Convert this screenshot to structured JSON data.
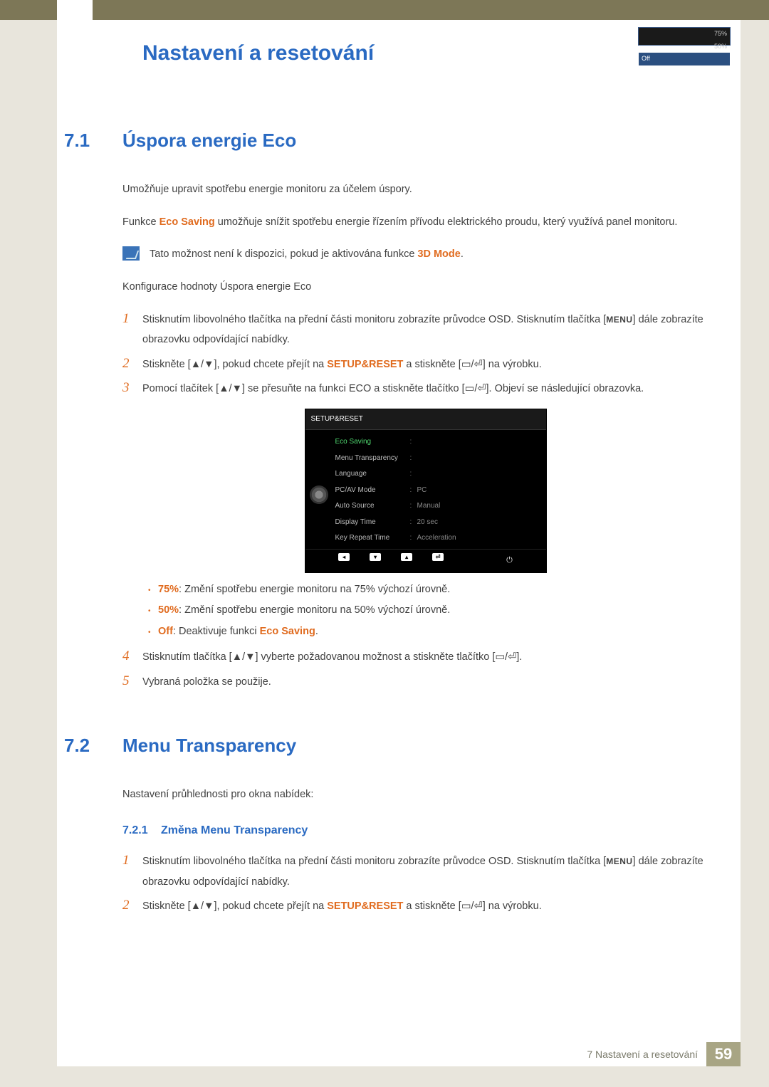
{
  "chapter_title": "Nastavení a resetování",
  "section1": {
    "num": "7.1",
    "title": "Úspora energie Eco",
    "p1": "Umožňuje upravit spotřebu energie monitoru za účelem úspory.",
    "p2a": "Funkce ",
    "p2_hl": "Eco Saving",
    "p2b": " umožňuje snížit spotřebu energie řízením přívodu elektrického proudu, který využívá panel monitoru.",
    "note_a": "Tato možnost není k dispozici, pokud je aktivována funkce ",
    "note_hl": "3D Mode",
    "note_b": ".",
    "config_line": "Konfigurace hodnoty Úspora energie Eco",
    "step1a": "Stisknutím libovolného tlačítka na přední části monitoru zobrazíte průvodce OSD. Stisknutím tlačítka [",
    "step1_menu": "MENU",
    "step1b": "] dále zobrazíte obrazovku odpovídající nabídky.",
    "step2a": "Stiskněte [",
    "step2b": "], pokud chcete přejít na ",
    "step2_hl": "SETUP&RESET",
    "step2c": " a stiskněte [",
    "step2d": "] na výrobku.",
    "step3a": "Pomocí tlačítek [",
    "step3b": "] se přesuňte na funkci ECO a stiskněte tlačítko [",
    "step3c": "]. Objeví se následující obrazovka.",
    "bullets": {
      "b1_hl": "75%",
      "b1": ": Změní spotřebu energie monitoru na 75% výchozí úrovně.",
      "b2_hl": "50%",
      "b2": ": Změní spotřebu energie monitoru na 50% výchozí úrovně.",
      "b3_hl1": "Off",
      "b3_mid": ": Deaktivuje funkci ",
      "b3_hl2": "Eco Saving",
      "b3_end": "."
    },
    "step4a": "Stisknutím tlačítka [",
    "step4b": "] vyberte požadovanou možnost a stiskněte tlačítko [",
    "step4c": "].",
    "step5": "Vybraná položka se použije.",
    "step_nums": {
      "s1": "1",
      "s2": "2",
      "s3": "3",
      "s4": "4",
      "s5": "5"
    }
  },
  "osd": {
    "title": "SETUP&RESET",
    "rows": {
      "r1": "Eco Saving",
      "r2": "Menu Transparency",
      "r3": "Language",
      "r4": "PC/AV Mode",
      "r5": "Auto Source",
      "r6": "Display Time",
      "r7": "Key Repeat Time"
    },
    "opts": {
      "o1": "75%",
      "o2": "50%",
      "o3": "Off"
    },
    "vals": {
      "v4": "PC",
      "v5": "Manual",
      "v6": "20 sec",
      "v7": "Acceleration"
    },
    "footer": {
      "b1": "◂",
      "b2": "▾",
      "b3": "▴",
      "b4": "⏎",
      "pow": "⏻"
    }
  },
  "section2": {
    "num": "7.2",
    "title": "Menu Transparency",
    "p1": "Nastavení průhlednosti pro okna nabídek:",
    "sub_num": "7.2.1",
    "sub_title": "Změna Menu Transparency",
    "step1a": "Stisknutím libovolného tlačítka na přední části monitoru zobrazíte průvodce OSD. Stisknutím tlačítka [",
    "step1_menu": "MENU",
    "step1b": "] dále zobrazíte obrazovku odpovídající nabídky.",
    "step2a": "Stiskněte [",
    "step2b": "], pokud chcete přejít na ",
    "step2_hl": "SETUP&RESET",
    "step2c": " a stiskněte [",
    "step2d": "] na výrobku.",
    "step_nums": {
      "s1": "1",
      "s2": "2"
    }
  },
  "footer": {
    "label": "7 Nastavení a resetování",
    "page": "59"
  }
}
